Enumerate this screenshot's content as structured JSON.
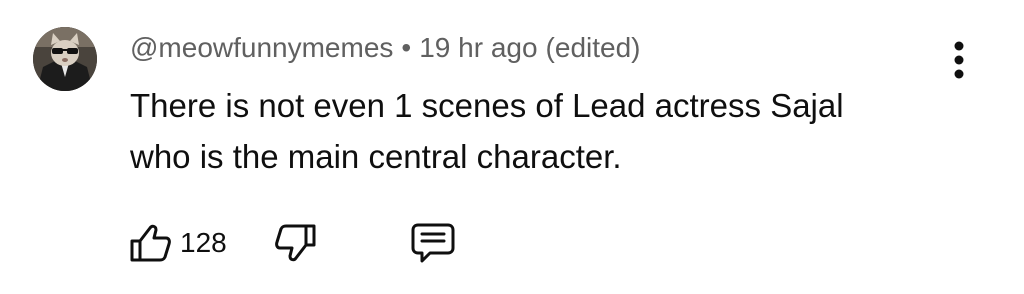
{
  "comment": {
    "author": "@meowfunnymemes",
    "separator": "•",
    "time": "19 hr ago",
    "edited": "(edited)",
    "text_lines": [
      "There is not even 1 scenes of Lead actress Sajal",
      "who is the main central character."
    ],
    "like_count": "128"
  },
  "icons": {
    "avatar": "cat-avatar-with-sunglasses",
    "more": "vertical-ellipsis-icon",
    "like": "thumbs-up-icon",
    "dislike": "thumbs-down-icon",
    "reply": "comment-bubble-icon"
  },
  "colors": {
    "primary_text": "#0f0f0f",
    "secondary_text": "#606060",
    "background": "#ffffff"
  }
}
